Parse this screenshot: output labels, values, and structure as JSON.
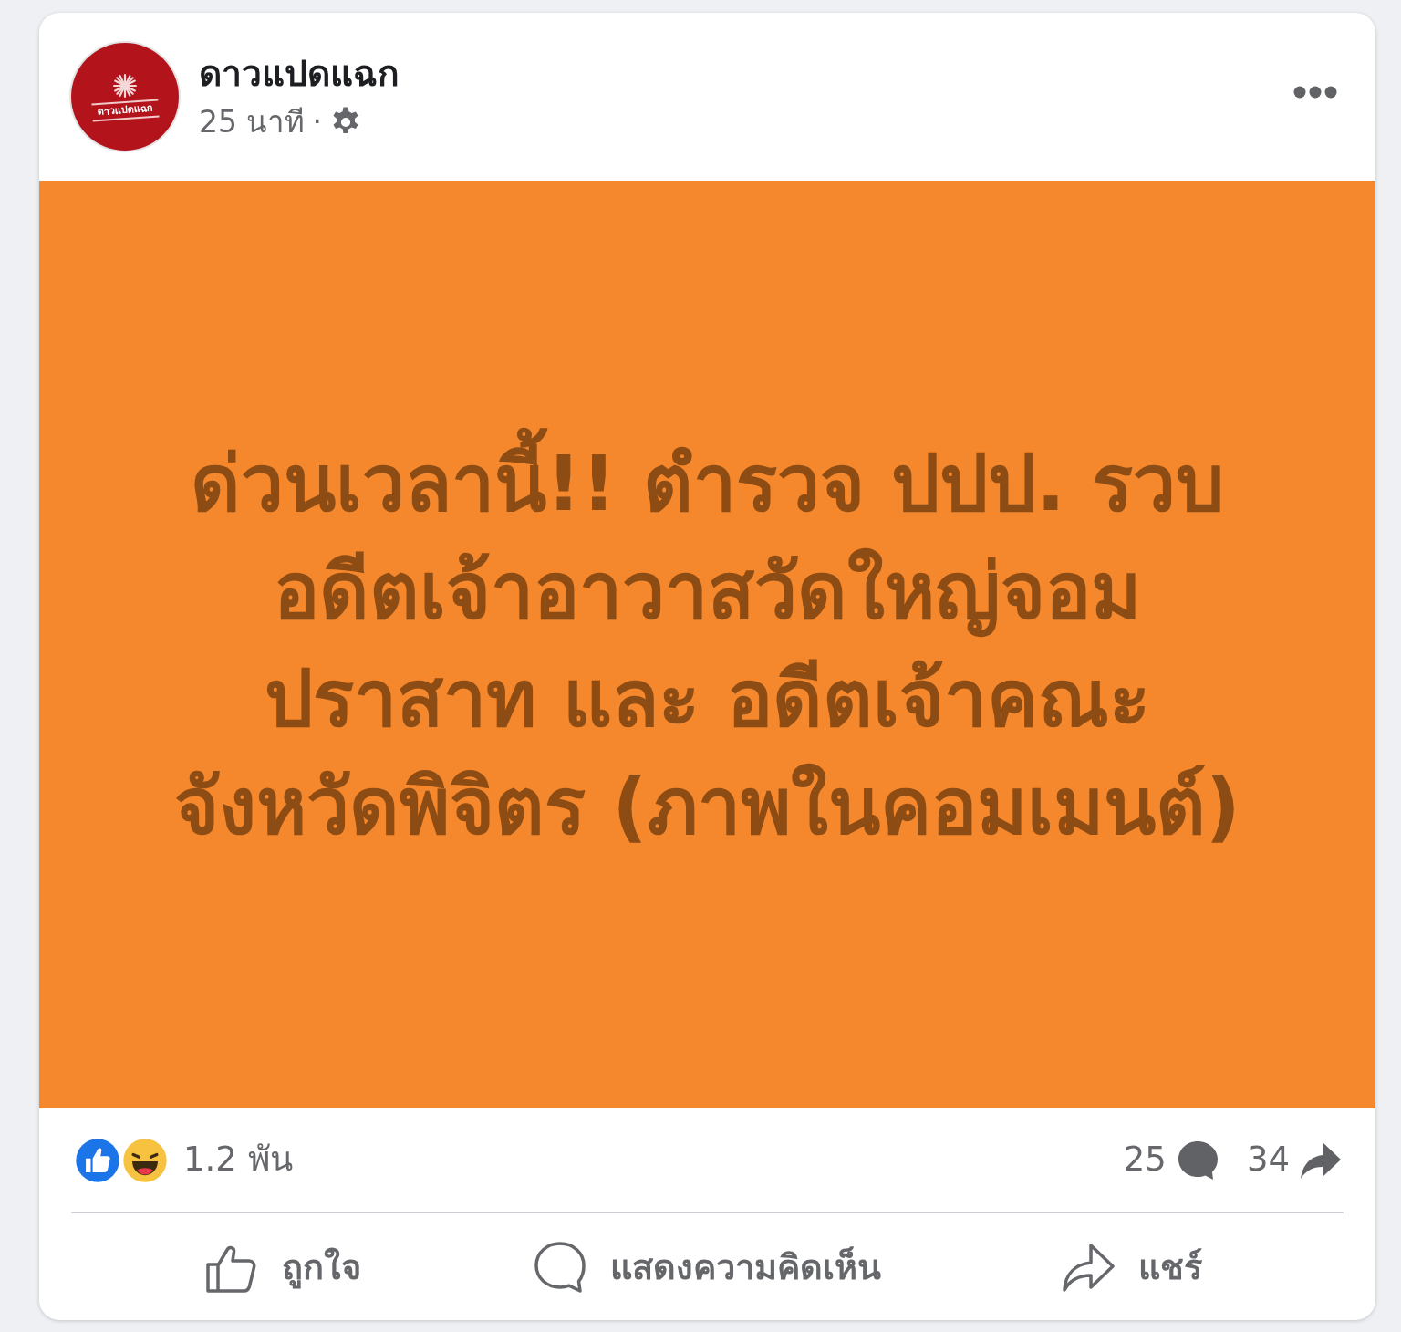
{
  "post": {
    "avatar": {
      "logo_text": "ดาวแปดแฉก"
    },
    "author": "ดาวแปดแฉก",
    "time": "25 นาที",
    "separator": "·"
  },
  "content": {
    "text": "ด่วนเวลานี้!! ตำรวจ ปปป. รวบ อดีตเจ้าอาวาสวัดใหญ่จอมปราสาท และ อดีตเจ้าคณะจังหวัดพิจิตร (ภาพในคอมเมนต์)"
  },
  "stats": {
    "reactions": [
      {
        "kind": "like"
      },
      {
        "kind": "haha"
      }
    ],
    "reaction_count": "1.2 พัน",
    "comments": "25",
    "shares": "34"
  },
  "actions": [
    {
      "kind": "like",
      "label": "ถูกใจ"
    },
    {
      "kind": "comment",
      "label": "แสดงความคิดเห็น"
    },
    {
      "kind": "share",
      "label": "แชร์"
    }
  ]
}
